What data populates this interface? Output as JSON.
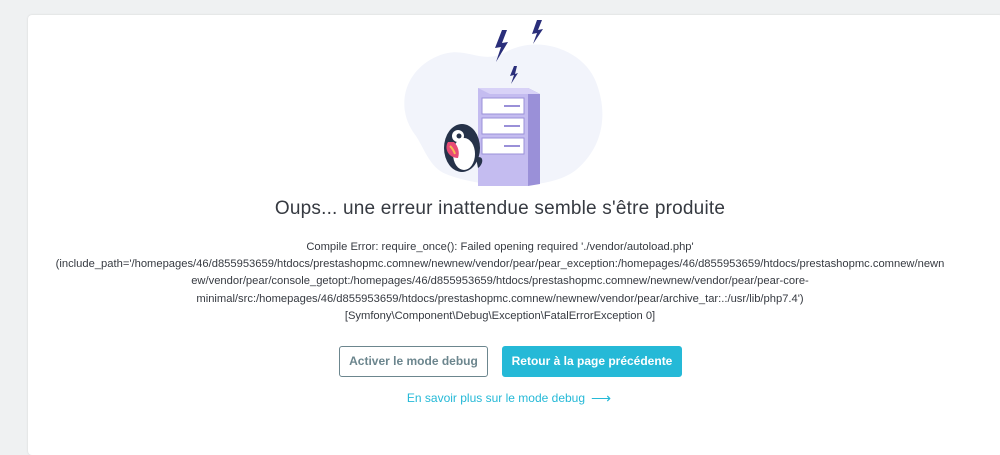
{
  "page": {
    "title": "Oups... une erreur inattendue semble s'être produite",
    "error_lines": [
      "Compile Error: require_once(): Failed opening required './vendor/autoload.php'",
      "(include_path='/homepages/46/d855953659/htdocs/prestashopmc.comnew/newnew/vendor/pear/pear_exception:/homepages/46/d855953659/htdocs/prestashopmc.comnew/newn",
      "ew/vendor/pear/console_getopt:/homepages/46/d855953659/htdocs/prestashopmc.comnew/newnew/vendor/pear/pear-core-",
      "minimal/src:/homepages/46/d855953659/htdocs/prestashopmc.comnew/newnew/vendor/pear/archive_tar:.:/usr/lib/php7.4')",
      "[Symfony\\Component\\Debug\\Exception\\FatalErrorException 0]"
    ]
  },
  "buttons": {
    "debug_label": "Activer le mode debug",
    "back_label": "Retour à la page précédente"
  },
  "link": {
    "label": "En savoir plus sur le mode debug",
    "arrow_icon": "arrow-right-icon"
  },
  "illustration": {
    "icons": [
      "server-icon",
      "lightning-icon",
      "puffin-mascot-icon"
    ]
  },
  "colors": {
    "accent": "#25b9d7",
    "secondary": "#6c868e",
    "text": "#363a41",
    "server": "#bdb5eb",
    "blob": "#f2f4fb"
  }
}
